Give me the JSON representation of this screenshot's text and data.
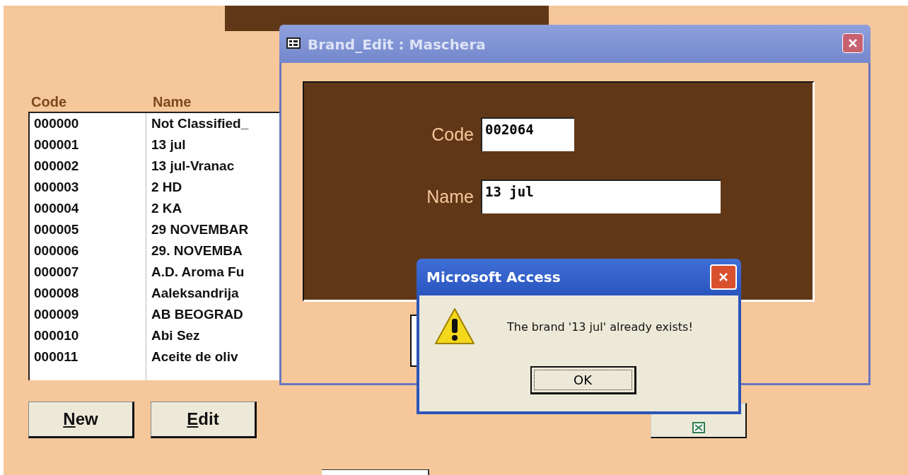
{
  "list": {
    "columns": [
      "Code",
      "Name"
    ],
    "rows": [
      {
        "code": "000000",
        "name": "Not Classified_"
      },
      {
        "code": "000001",
        "name": "13 jul"
      },
      {
        "code": "000002",
        "name": "13 jul-Vranac"
      },
      {
        "code": "000003",
        "name": "2 HD"
      },
      {
        "code": "000004",
        "name": "2 KA"
      },
      {
        "code": "000005",
        "name": "29 NOVEMBAR"
      },
      {
        "code": "000006",
        "name": "29. NOVEMBA"
      },
      {
        "code": "000007",
        "name": "A.D. Aroma Fu"
      },
      {
        "code": "000008",
        "name": "Aaleksandrija"
      },
      {
        "code": "000009",
        "name": "AB BEOGRAD"
      },
      {
        "code": "000010",
        "name": "Abi Sez"
      },
      {
        "code": "000011",
        "name": "Aceite de oliv"
      }
    ]
  },
  "buttons": [
    {
      "label": "New"
    },
    {
      "label": "Edit"
    }
  ],
  "edit_window": {
    "title": "Brand_Edit : Maschera",
    "fields": [
      {
        "label": "Code",
        "value": "002064",
        "kind": "short"
      },
      {
        "label": "Name",
        "value": "13 jul",
        "kind": "long"
      }
    ]
  },
  "message_box": {
    "title": "Microsoft Access",
    "message": "The brand '13 jul' already exists!",
    "button": "OK"
  }
}
